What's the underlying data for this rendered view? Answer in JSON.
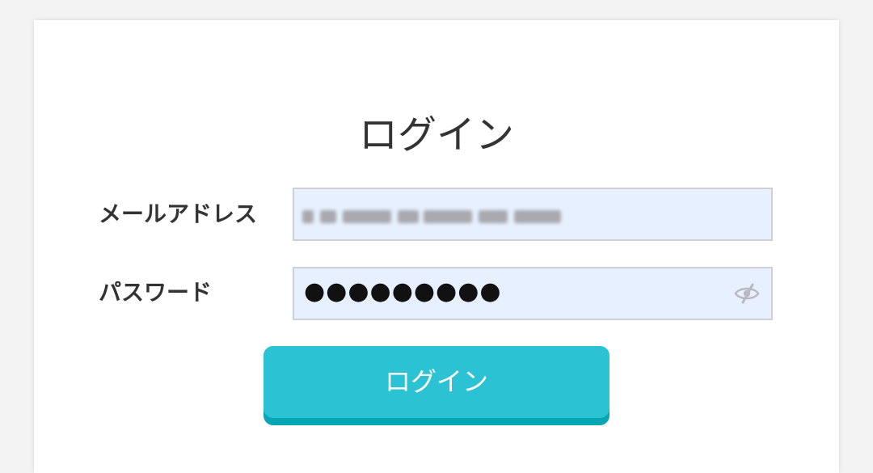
{
  "login": {
    "title": "ログイン",
    "email": {
      "label": "メールアドレス",
      "value": "••••••••••••••••"
    },
    "password": {
      "label": "パスワード",
      "value": "●●●●●●●●●",
      "toggle_icon": "eye-slash-icon"
    },
    "submit_label": "ログイン"
  },
  "colors": {
    "background": "#f3f3f3",
    "card": "#ffffff",
    "input_bg": "#e6f0fe",
    "input_border": "#cfcfd6",
    "button": "#2bc3d4",
    "button_shadow": "#06a6b5",
    "text": "#333333"
  }
}
